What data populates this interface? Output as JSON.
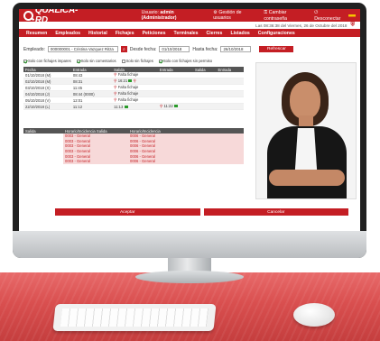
{
  "brand": {
    "logo_text": "QUALICA-RD"
  },
  "header": {
    "user_prefix": "Usuario:",
    "user_name": "admin (Administrador)",
    "links": [
      "Gestión de usuarios",
      "Cambiar contraseña",
      "Desconectar"
    ],
    "datetime": "Las 08:36:38 del Viernes, 26 de Octubre del 2018"
  },
  "nav": [
    "Resumen",
    "Empleados",
    "Historial",
    "Fichajes",
    "Peticiones",
    "Terminales",
    "Cierres",
    "Listados",
    "Configuraciones"
  ],
  "filters": {
    "employee_label": "Empleado:",
    "employee_value": "000000001 - Cristina Vazquez Ritza",
    "from_label": "Desde fecha:",
    "from_value": "01/10/2018",
    "to_label": "Hasta fecha:",
    "to_value": "26/10/2018",
    "refresh_label": "Refrescar"
  },
  "checks": [
    {
      "label": "Solo con fichajes impares",
      "checked": true
    },
    {
      "label": "Solo sin comentarios",
      "checked": true
    },
    {
      "label": "Solo sin fichajes",
      "checked": false
    },
    {
      "label": "Solo con fichajes sin permiso",
      "checked": true
    }
  ],
  "fichajes": {
    "columns": [
      "Fecha",
      "Entrada",
      "Salida",
      "Entrada",
      "Salida",
      "Entrada"
    ],
    "rows": [
      {
        "fecha": "01/10/2018 (M)",
        "entrada": "08:43",
        "salida": "Falta fichaje"
      },
      {
        "fecha": "02/10/2018 (M)",
        "entrada": "08:31",
        "salida": "16:21"
      },
      {
        "fecha": "03/10/2018 (X)",
        "entrada": "11:45",
        "salida": "Falta fichaje"
      },
      {
        "fecha": "04/10/2018 (J)",
        "entrada": "08:44 (0000)",
        "salida": "Falta fichaje"
      },
      {
        "fecha": "05/10/2018 (V)",
        "entrada": "12:01",
        "salida": "Falta fichaje"
      },
      {
        "fecha": "22/10/2018 (L)",
        "entrada": "11:12",
        "salida": "11:13",
        "entrada2": "11:22"
      }
    ]
  },
  "horarios": {
    "columns": [
      "Salida",
      "Horario/Incidencia Salida",
      "Horario/Incidencia"
    ],
    "rows": [
      {
        "inc_salida": "0003 - General",
        "inc": "0006 - General"
      },
      {
        "inc_salida": "0003 - General",
        "inc": "0006 - General"
      },
      {
        "inc_salida": "0003 - General",
        "inc": "0006 - General"
      },
      {
        "inc_salida": "0003 - General",
        "inc": "0006 - General"
      },
      {
        "inc_salida": "0003 - General",
        "inc": "0006 - General"
      },
      {
        "inc_salida": "0003 - General",
        "inc": "0006 - General"
      }
    ]
  },
  "buttons": {
    "accept": "Aceptar",
    "cancel": "Cancelar"
  },
  "colors": {
    "brand": "#c41e24",
    "ok": "#2a9b2a",
    "header_dark": "#555555"
  }
}
